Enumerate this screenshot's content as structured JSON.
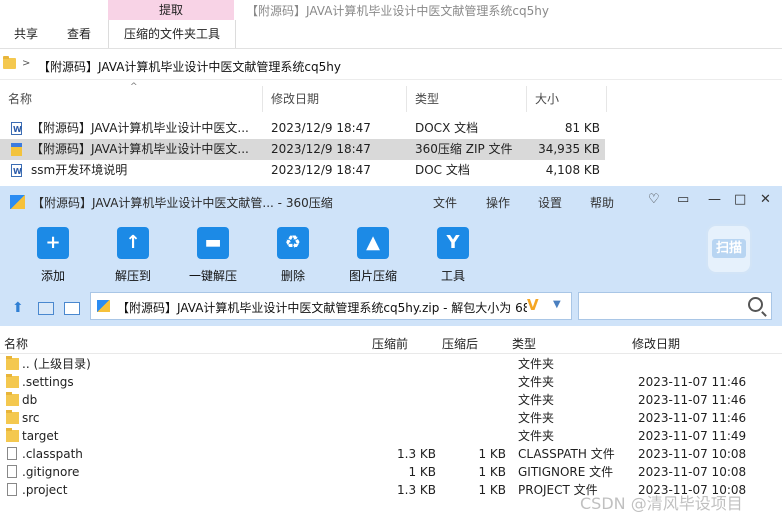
{
  "explorer": {
    "context_tab": "提取",
    "window_title": "【附源码】JAVA计算机毕业设计中医文献管理系统cq5hy",
    "tabs": [
      "共享",
      "查看",
      "压缩的文件夹工具"
    ],
    "address_path": "【附源码】JAVA计算机毕业设计中医文献管理系统cq5hy",
    "columns": [
      "名称",
      "修改日期",
      "类型",
      "大小"
    ],
    "files": [
      {
        "name": "【附源码】JAVA计算机毕业设计中医文...",
        "date": "2023/12/9 18:47",
        "type": "DOCX 文档",
        "size": "81 KB",
        "icon": "word-icon",
        "selected": false
      },
      {
        "name": "【附源码】JAVA计算机毕业设计中医文...",
        "date": "2023/12/9 18:47",
        "type": "360压缩 ZIP 文件",
        "size": "34,935 KB",
        "icon": "zip-icon",
        "selected": true
      },
      {
        "name": "ssm开发环境说明",
        "date": "2023/12/9 18:47",
        "type": "DOC 文档",
        "size": "4,108 KB",
        "icon": "word-icon",
        "selected": false
      }
    ]
  },
  "zip360": {
    "title": "【附源码】JAVA计算机毕业设计中医文献管... - 360压缩",
    "menu": [
      "文件",
      "操作",
      "设置",
      "帮助"
    ],
    "tools": [
      {
        "label": "添加",
        "icon": "add-icon",
        "glyph": "+"
      },
      {
        "label": "解压到",
        "icon": "extract-to-icon",
        "glyph": "↑"
      },
      {
        "label": "一键解压",
        "icon": "one-click-extract-icon",
        "glyph": "▬"
      },
      {
        "label": "删除",
        "icon": "delete-icon",
        "glyph": "♻"
      },
      {
        "label": "图片压缩",
        "icon": "image-compress-icon",
        "glyph": "▲"
      },
      {
        "label": "工具",
        "icon": "tools-icon",
        "glyph": "Y"
      }
    ],
    "scan_label": "扫描",
    "path_text": "【附源码】JAVA计算机毕业设计中医文献管理系统cq5hy.zip - 解包大小为 68",
    "columns": [
      "名称",
      "压缩前",
      "压缩后",
      "类型",
      "修改日期"
    ],
    "rows": [
      {
        "name": ".. (上级目录)",
        "before": "",
        "after": "",
        "type": "文件夹",
        "date": "",
        "kind": "folder"
      },
      {
        "name": ".settings",
        "before": "",
        "after": "",
        "type": "文件夹",
        "date": "2023-11-07 11:46",
        "kind": "folder"
      },
      {
        "name": "db",
        "before": "",
        "after": "",
        "type": "文件夹",
        "date": "2023-11-07 11:46",
        "kind": "folder"
      },
      {
        "name": "src",
        "before": "",
        "after": "",
        "type": "文件夹",
        "date": "2023-11-07 11:46",
        "kind": "folder"
      },
      {
        "name": "target",
        "before": "",
        "after": "",
        "type": "文件夹",
        "date": "2023-11-07 11:49",
        "kind": "folder"
      },
      {
        "name": ".classpath",
        "before": "1.3 KB",
        "after": "1 KB",
        "type": "CLASSPATH 文件",
        "date": "2023-11-07 10:08",
        "kind": "file"
      },
      {
        "name": ".gitignore",
        "before": "1 KB",
        "after": "1 KB",
        "type": "GITIGNORE 文件",
        "date": "2023-11-07 10:08",
        "kind": "file"
      },
      {
        "name": ".project",
        "before": "1.3 KB",
        "after": "1 KB",
        "type": "PROJECT 文件",
        "date": "2023-11-07 10:08",
        "kind": "file"
      }
    ]
  },
  "watermark": "CSDN @清风毕设项目"
}
